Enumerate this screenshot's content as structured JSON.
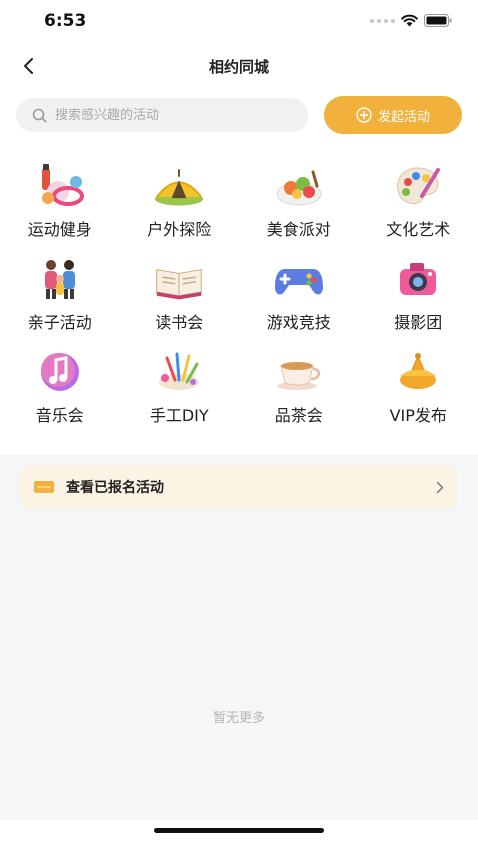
{
  "status": {
    "time": "6:53"
  },
  "nav": {
    "title": "相约同城"
  },
  "search": {
    "placeholder": "搜索感兴趣的活动",
    "launch_label": "发起活动"
  },
  "categories": [
    {
      "label": "运动健身",
      "icon": "fitness-icon"
    },
    {
      "label": "户外探险",
      "icon": "tent-icon"
    },
    {
      "label": "美食派对",
      "icon": "food-platter-icon"
    },
    {
      "label": "文化艺术",
      "icon": "art-palette-icon"
    },
    {
      "label": "亲子活动",
      "icon": "family-icon"
    },
    {
      "label": "读书会",
      "icon": "open-book-icon"
    },
    {
      "label": "游戏竞技",
      "icon": "gamepad-icon"
    },
    {
      "label": "摄影团",
      "icon": "camera-icon"
    },
    {
      "label": "音乐会",
      "icon": "music-note-icon"
    },
    {
      "label": "手工DIY",
      "icon": "craft-tools-icon"
    },
    {
      "label": "品茶会",
      "icon": "teacup-icon"
    },
    {
      "label": "VIP发布",
      "icon": "vip-crown-icon"
    }
  ],
  "registered": {
    "label": "查看已报名活动"
  },
  "empty_text": "暂无更多",
  "colors": {
    "accent": "#f2b13c",
    "card_bg": "#fbf3e4",
    "page_bg": "#f5f6f8"
  }
}
